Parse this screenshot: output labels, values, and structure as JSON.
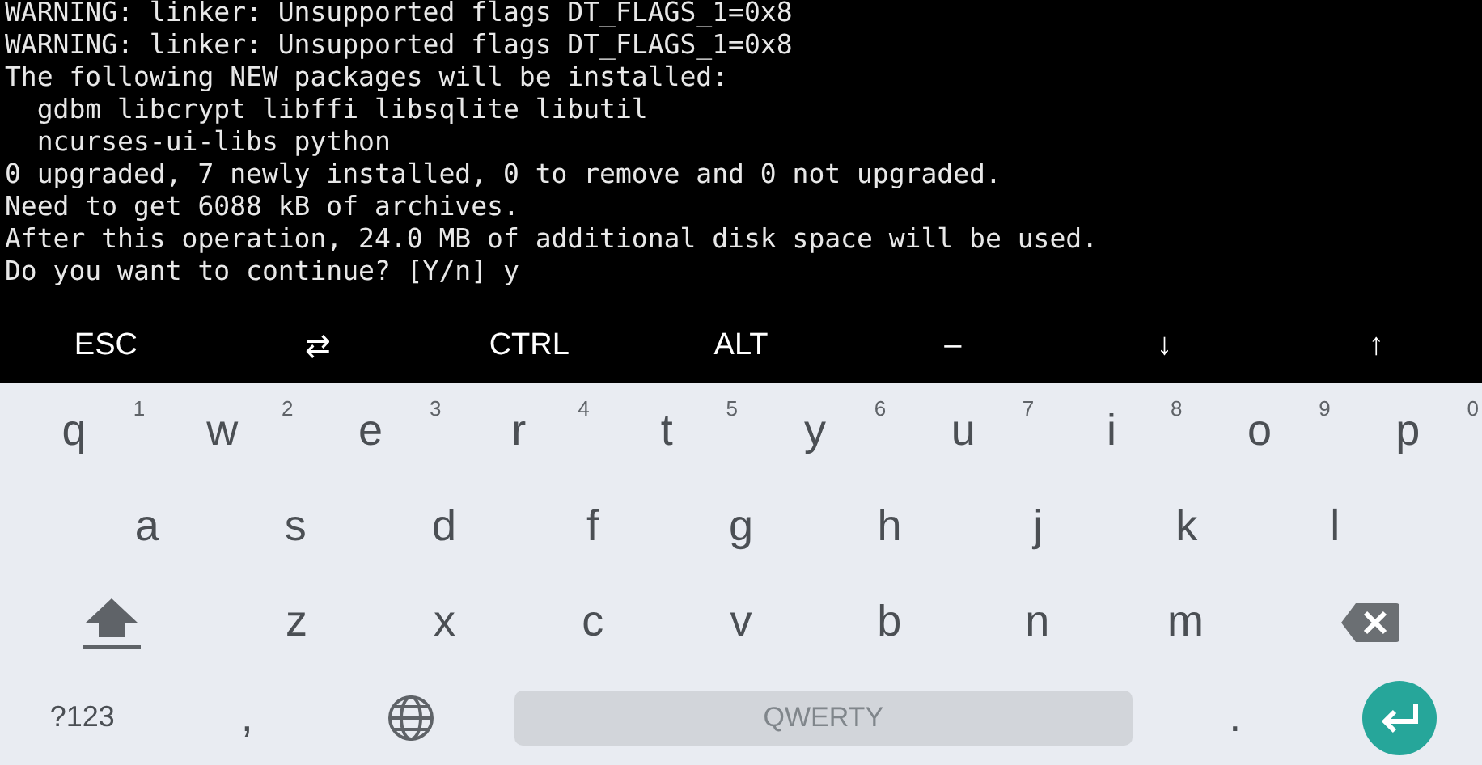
{
  "terminal": {
    "lines": [
      "WARNING: linker: Unsupported flags DT_FLAGS_1=0x8",
      "WARNING: linker: Unsupported flags DT_FLAGS_1=0x8",
      "The following NEW packages will be installed:",
      "  gdbm libcrypt libffi libsqlite libutil",
      "  ncurses-ui-libs python",
      "0 upgraded, 7 newly installed, 0 to remove and 0 not upgraded.",
      "Need to get 6088 kB of archives.",
      "After this operation, 24.0 MB of additional disk space will be used.",
      "Do you want to continue? [Y/n] y"
    ]
  },
  "extra_keys": [
    "ESC",
    "⇄",
    "CTRL",
    "ALT",
    "–",
    "↓",
    "↑"
  ],
  "keyboard": {
    "rows": [
      [
        {
          "kind": "letter",
          "label": "q",
          "hint": "1"
        },
        {
          "kind": "letter",
          "label": "w",
          "hint": "2"
        },
        {
          "kind": "letter",
          "label": "e",
          "hint": "3"
        },
        {
          "kind": "letter",
          "label": "r",
          "hint": "4"
        },
        {
          "kind": "letter",
          "label": "t",
          "hint": "5"
        },
        {
          "kind": "letter",
          "label": "y",
          "hint": "6"
        },
        {
          "kind": "letter",
          "label": "u",
          "hint": "7"
        },
        {
          "kind": "letter",
          "label": "i",
          "hint": "8"
        },
        {
          "kind": "letter",
          "label": "o",
          "hint": "9"
        },
        {
          "kind": "letter",
          "label": "p",
          "hint": "0"
        }
      ],
      [
        {
          "kind": "letter",
          "label": "a"
        },
        {
          "kind": "letter",
          "label": "s"
        },
        {
          "kind": "letter",
          "label": "d"
        },
        {
          "kind": "letter",
          "label": "f"
        },
        {
          "kind": "letter",
          "label": "g"
        },
        {
          "kind": "letter",
          "label": "h"
        },
        {
          "kind": "letter",
          "label": "j"
        },
        {
          "kind": "letter",
          "label": "k"
        },
        {
          "kind": "letter",
          "label": "l"
        }
      ],
      [
        {
          "kind": "shift"
        },
        {
          "kind": "letter",
          "label": "z"
        },
        {
          "kind": "letter",
          "label": "x"
        },
        {
          "kind": "letter",
          "label": "c"
        },
        {
          "kind": "letter",
          "label": "v"
        },
        {
          "kind": "letter",
          "label": "b"
        },
        {
          "kind": "letter",
          "label": "n"
        },
        {
          "kind": "letter",
          "label": "m"
        },
        {
          "kind": "backspace"
        }
      ],
      [
        {
          "kind": "symbols",
          "label": "?123"
        },
        {
          "kind": "letter",
          "label": ","
        },
        {
          "kind": "globe"
        },
        {
          "kind": "space",
          "label": "QWERTY"
        },
        {
          "kind": "letter",
          "label": "."
        },
        {
          "kind": "enter"
        }
      ]
    ]
  }
}
